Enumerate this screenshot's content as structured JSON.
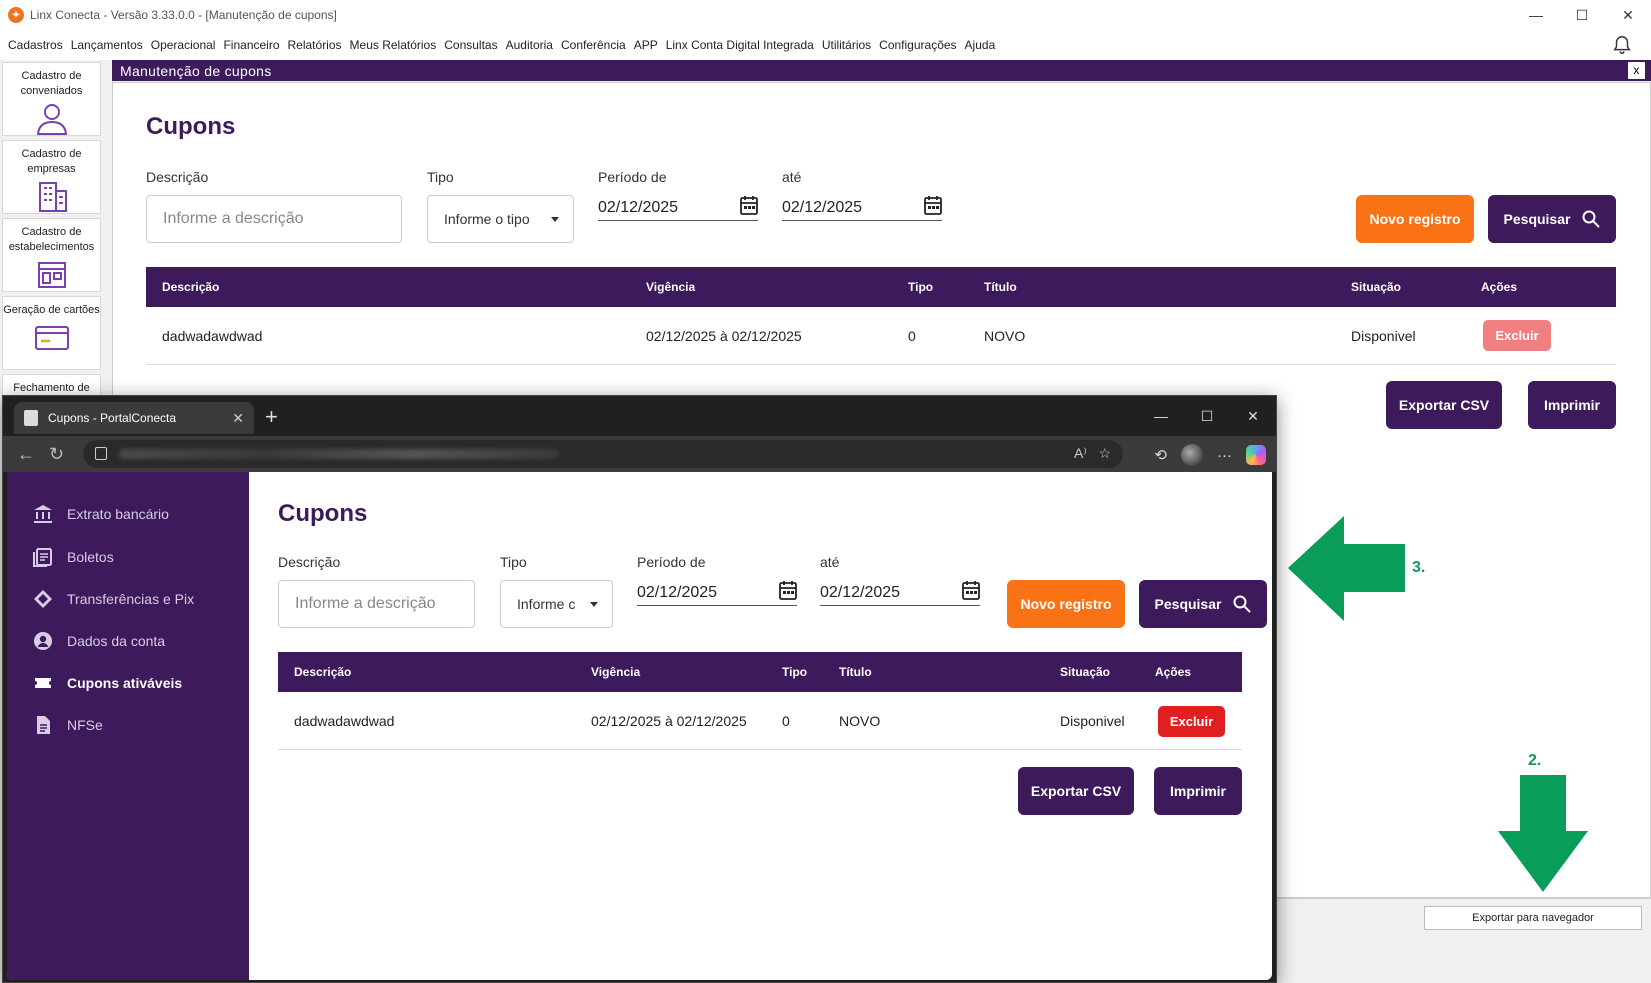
{
  "app": {
    "title": "Linx Conecta - Versão 3.33.0.0 - [Manutenção de cupons]",
    "window_controls": [
      "—",
      "☐",
      "✕"
    ],
    "menu": [
      "Cadastros",
      "Lançamentos",
      "Operacional",
      "Financeiro",
      "Relatórios",
      "Meus Relatórios",
      "Consultas",
      "Auditoria",
      "Conferência",
      "APP",
      "Linx Conta Digital Integrada",
      "Utilitários",
      "Configurações",
      "Ajuda"
    ],
    "nav_tiles": [
      {
        "label": "Cadastro de conveniados",
        "icon": "person-icon"
      },
      {
        "label": "Cadastro de empresas",
        "icon": "building-icon"
      },
      {
        "label": "Cadastro de estabelecimentos",
        "icon": "store-icon"
      },
      {
        "label": "Geração de cartões",
        "icon": "card-icon"
      },
      {
        "label": "Fechamento de",
        "icon": ""
      }
    ],
    "panel_title": "Manutenção de cupons",
    "panel_close": "x",
    "export_button": "Exportar para navegador"
  },
  "cupons": {
    "title": "Cupons",
    "descricao_label": "Descrição",
    "descricao_placeholder": "Informe a descrição",
    "tipo_label": "Tipo",
    "tipo_value": "Informe o tipo",
    "periodo_label": "Período de",
    "periodo_de": "02/12/2025",
    "ate_label": "até",
    "periodo_ate": "02/12/2025",
    "novo_registro": "Novo registro",
    "pesquisar": "Pesquisar",
    "columns": [
      "Descrição",
      "Vigência",
      "Tipo",
      "Título",
      "Situação",
      "Ações"
    ],
    "rows": [
      {
        "descricao": "dadwadawdwad",
        "vigencia": "02/12/2025 à 02/12/2025",
        "tipo": "0",
        "titulo": "NOVO",
        "situacao": "Disponivel",
        "acao": "Excluir"
      }
    ],
    "exportar_csv": "Exportar CSV",
    "imprimir": "Imprimir"
  },
  "browser": {
    "tab_title": "Cupons - PortalConecta",
    "new_tab": "+",
    "tab_close": "✕",
    "window_controls": [
      "—",
      "☐",
      "✕"
    ],
    "toolbar_icons": [
      "back-icon",
      "refresh-icon",
      "lock-icon",
      "read-aloud-icon",
      "favorite-icon",
      "history-icon",
      "profile-icon",
      "more-icon",
      "copilot-icon"
    ],
    "sidebar": [
      {
        "label": "Extrato bancário",
        "icon": "bank-icon",
        "active": false
      },
      {
        "label": "Boletos",
        "icon": "boleto-icon",
        "active": false
      },
      {
        "label": "Transferências e Pix",
        "icon": "pix-icon",
        "active": false
      },
      {
        "label": "Dados da conta",
        "icon": "account-icon",
        "active": false
      },
      {
        "label": "Cupons ativáveis",
        "icon": "coupon-icon",
        "active": true
      },
      {
        "label": "NFSe",
        "icon": "document-icon",
        "active": false
      }
    ],
    "tipo_value_truncated": "Informe c"
  },
  "annotations": {
    "step2": "2.",
    "step3": "3.",
    "arrow_color": "#0a9d5a"
  },
  "colors": {
    "brand_purple": "#3d1a5c",
    "orange": "#f97316",
    "excluir_pale": "#f08080",
    "excluir_red": "#e02020"
  }
}
